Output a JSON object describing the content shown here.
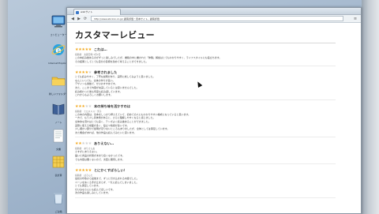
{
  "desktop": {
    "icons": [
      {
        "name": "computer-icon",
        "label": "コンピューター"
      },
      {
        "name": "ie-icon",
        "label": "Internet Explorer"
      },
      {
        "name": "folder-icon",
        "label": "新しいフォルダー"
      },
      {
        "name": "book-icon",
        "label": "ノート"
      },
      {
        "name": "document-icon",
        "label": "文書"
      },
      {
        "name": "spreadsheet-icon",
        "label": "表計算"
      },
      {
        "name": "recycle-bin-icon",
        "label": "ごみ箱"
      }
    ]
  },
  "browser": {
    "tab_title": "webサイト",
    "url": "http://www.abcxxx.co.jp/ 顧客評価・見本サイト、顧客評価",
    "back_glyph": "◀",
    "forward_glyph": "▶",
    "reload_glyph": "⟳",
    "menu_glyph": "≡"
  },
  "page": {
    "title": "カスタマーレビュー",
    "reviews": [
      {
        "stars": 5,
        "title": "これは…",
        "meta": "投稿者　太郎日時 1月2日",
        "lines": [
          "この本読み始めるのがずっと楽しみでしたが、書籍の中に書かれた「体験」解説はとてもわかりやすく、ライフスタイルにも役立ちます。",
          "その結果としてとても自分の目標を改めて考えることができました。"
        ]
      },
      {
        "stars": 4,
        "title": "参考されました",
        "meta": "",
        "lines": [
          "とても読みやすく、丁寧な説明があり、実際に試してみようと思いました。",
          "なんといっても、全体の作りが良い。",
          "デザインも素敵で、ぜひおすすめです。",
          "また、ここまで内容が充実しているとは思いませんでした。",
          "読み終わった後も何度も読み返しています。",
          "これからもよろしくお願いします。"
        ]
      },
      {
        "stars": 3,
        "title": "本の持ち味を活かすのは",
        "meta": "投稿者　ヒロスミス・男子",
        "lines": [
          "この本の内容は、基本をしっかり押さえていて、初めての人にもわかりやすい構成になっていると思います。",
          "一方で、もう少し具体例があると、さらに理解しやすくなると感じました。",
          "全体的な流れはとても良く、テンポよく読み進めることができました。",
          "実際に使える場面が多く、役立つ情報が多いです。",
          "少し細かい部分で説明が足りないところもありましたが、全体としては満足しています。",
          "また機会があれば、他の作品も読んでみたいと思います。"
        ]
      },
      {
        "stars": 2,
        "title": "ありえない…",
        "meta": "投稿者　ありさん女",
        "lines": [
          "さすがにありえない。",
          "届いた商品の状態があまり良くなかったです。",
          "でも内容は悪くないので、次回に期待します。"
        ]
      },
      {
        "stars": 5,
        "title": "とにかくすばらしい！",
        "meta": "投稿者　ぱるんた",
        "lines": [
          "最初の印象から最後まで、ずっと引き込まれる内容でした。",
          "ページをめくる手が止まらず、一気に読んでしまいました。",
          "とても満足しています。",
          "ぜひみなさんにも読んでほしいです。",
          "次の作品も楽しみにしています。"
        ]
      }
    ]
  }
}
